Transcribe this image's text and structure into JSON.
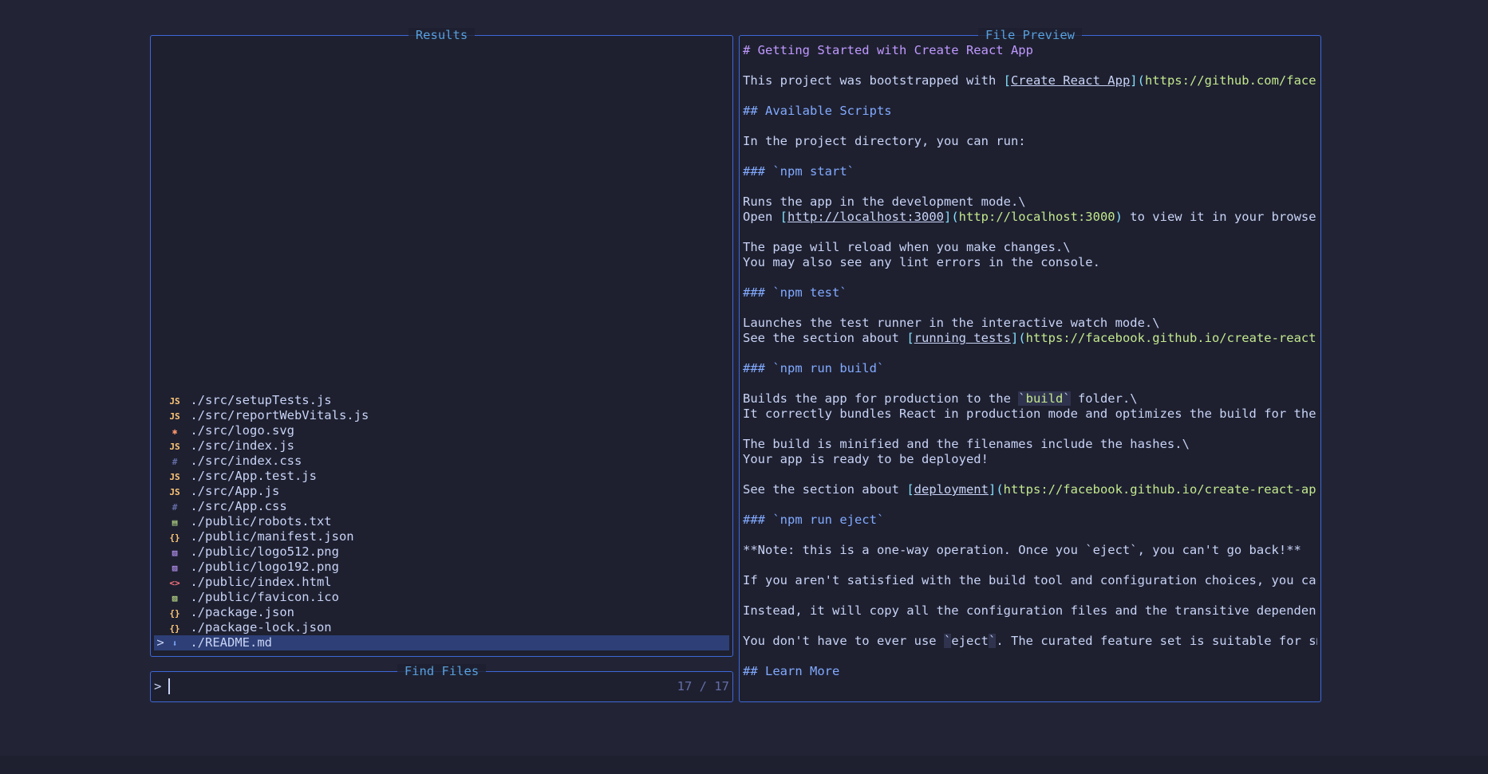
{
  "results": {
    "title": "Results",
    "items": [
      {
        "icon": "JS",
        "icon_name": "javascript-icon",
        "color": "#ffc777",
        "path": "./src/setupTests.js"
      },
      {
        "icon": "JS",
        "icon_name": "javascript-icon",
        "color": "#ffc777",
        "path": "./src/reportWebVitals.js"
      },
      {
        "icon": "✱",
        "icon_name": "svg-icon",
        "color": "#ff966c",
        "path": "./src/logo.svg"
      },
      {
        "icon": "JS",
        "icon_name": "javascript-icon",
        "color": "#ffc777",
        "path": "./src/index.js"
      },
      {
        "icon": "#",
        "icon_name": "css-icon",
        "color": "#636da6",
        "path": "./src/index.css"
      },
      {
        "icon": "JS",
        "icon_name": "javascript-icon",
        "color": "#ffc777",
        "path": "./src/App.test.js"
      },
      {
        "icon": "JS",
        "icon_name": "javascript-icon",
        "color": "#ffc777",
        "path": "./src/App.js"
      },
      {
        "icon": "#",
        "icon_name": "css-icon",
        "color": "#636da6",
        "path": "./src/App.css"
      },
      {
        "icon": "▤",
        "icon_name": "text-file-icon",
        "color": "#c3e88d",
        "path": "./public/robots.txt"
      },
      {
        "icon": "{}",
        "icon_name": "json-icon",
        "color": "#ffc777",
        "path": "./public/manifest.json"
      },
      {
        "icon": "▨",
        "icon_name": "image-icon",
        "color": "#c099ff",
        "path": "./public/logo512.png"
      },
      {
        "icon": "▨",
        "icon_name": "image-icon",
        "color": "#c099ff",
        "path": "./public/logo192.png"
      },
      {
        "icon": "<>",
        "icon_name": "html-icon",
        "color": "#ff757f",
        "path": "./public/index.html"
      },
      {
        "icon": "▨",
        "icon_name": "favicon-icon",
        "color": "#c3e88d",
        "path": "./public/favicon.ico"
      },
      {
        "icon": "{}",
        "icon_name": "json-icon",
        "color": "#ffc777",
        "path": "./package.json"
      },
      {
        "icon": "{}",
        "icon_name": "json-icon",
        "color": "#ffc777",
        "path": "./package-lock.json"
      },
      {
        "icon": "⬇",
        "icon_name": "markdown-icon",
        "color": "#82aaff",
        "path": "./README.md"
      }
    ],
    "selected_index": 16,
    "caret": ">"
  },
  "finder": {
    "title": "Find Files",
    "prompt": ">",
    "counter": "17 / 17"
  },
  "preview": {
    "title": "File Preview",
    "lines": [
      [
        [
          "h1",
          "# Getting Started with Create React App"
        ]
      ],
      [],
      [
        [
          "t",
          "This project was bootstrapped with "
        ],
        [
          "br",
          "["
        ],
        [
          "lnk",
          "Create React App"
        ],
        [
          "br",
          "]("
        ],
        [
          "url",
          "https://github.com/faceboo"
        ]
      ],
      [],
      [
        [
          "hmark",
          "## "
        ],
        [
          "h2",
          "Available Scripts"
        ]
      ],
      [],
      [
        [
          "t",
          "In the project directory, you can run:"
        ]
      ],
      [],
      [
        [
          "hmark",
          "### "
        ],
        [
          "h2",
          "`npm start`"
        ]
      ],
      [],
      [
        [
          "t",
          "Runs the app in the development mode.\\"
        ]
      ],
      [
        [
          "t",
          "Open "
        ],
        [
          "br",
          "["
        ],
        [
          "lnk",
          "http://localhost:3000"
        ],
        [
          "br",
          "]("
        ],
        [
          "url",
          "http://localhost:3000"
        ],
        [
          "br",
          ")"
        ],
        [
          "t",
          " to view it in your browser."
        ]
      ],
      [],
      [
        [
          "t",
          "The page will reload when you make changes.\\"
        ]
      ],
      [
        [
          "t",
          "You may also see any lint errors in the console."
        ]
      ],
      [],
      [
        [
          "hmark",
          "### "
        ],
        [
          "h2",
          "`npm test`"
        ]
      ],
      [],
      [
        [
          "t",
          "Launches the test runner in the interactive watch mode.\\"
        ]
      ],
      [
        [
          "t",
          "See the section about "
        ],
        [
          "br",
          "["
        ],
        [
          "lnk",
          "running tests"
        ],
        [
          "br",
          "]("
        ],
        [
          "url",
          "https://facebook.github.io/create-react-ap"
        ]
      ],
      [],
      [
        [
          "hmark",
          "### "
        ],
        [
          "h2",
          "`npm run build`"
        ]
      ],
      [],
      [
        [
          "t",
          "Builds the app for production to the "
        ],
        [
          "tick",
          "`"
        ],
        [
          "code",
          "build"
        ],
        [
          "tick",
          "`"
        ],
        [
          "t",
          " folder.\\"
        ]
      ],
      [
        [
          "t",
          "It correctly bundles React in production mode and optimizes the build for the be"
        ]
      ],
      [],
      [
        [
          "t",
          "The build is minified and the filenames include the hashes.\\"
        ]
      ],
      [
        [
          "t",
          "Your app is ready to be deployed!"
        ]
      ],
      [],
      [
        [
          "t",
          "See the section about "
        ],
        [
          "br",
          "["
        ],
        [
          "lnk",
          "deployment"
        ],
        [
          "br",
          "]("
        ],
        [
          "url",
          "https://facebook.github.io/create-react-app/d"
        ]
      ],
      [],
      [
        [
          "hmark",
          "### "
        ],
        [
          "h2",
          "`npm run eject`"
        ]
      ],
      [],
      [
        [
          "t",
          "**Note: this is a one-way operation. Once you `eject`, you can't go back!**"
        ]
      ],
      [],
      [
        [
          "t",
          "If you aren't satisfied with the build tool and configuration choices, you can "
        ],
        [
          "tick",
          "`"
        ]
      ],
      [],
      [
        [
          "t",
          "Instead, it will copy all the configuration files and the transitive dependencie"
        ]
      ],
      [],
      [
        [
          "t",
          "You don't have to ever use "
        ],
        [
          "tick",
          "`"
        ],
        [
          "t",
          "eject"
        ],
        [
          "tick",
          "`"
        ],
        [
          "t",
          ". The curated feature set is suitable for smal"
        ]
      ],
      [],
      [
        [
          "hmark",
          "## "
        ],
        [
          "h2",
          "Learn More"
        ]
      ]
    ]
  }
}
